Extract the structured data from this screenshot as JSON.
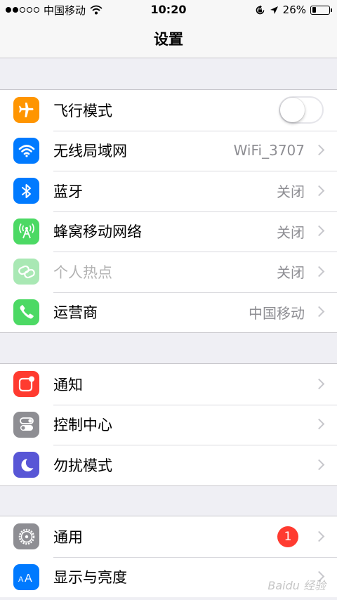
{
  "status_bar": {
    "carrier": "中国移动",
    "time": "10:20",
    "battery_percent": "26%",
    "battery_level": 0.26
  },
  "nav": {
    "title": "设置"
  },
  "groups": [
    [
      {
        "label": "飞行模式",
        "icon": "airplane-icon",
        "color": "#ff9500",
        "toggle": false
      },
      {
        "label": "无线局域网",
        "icon": "wifi-icon",
        "color": "#007aff",
        "value": "WiFi_3707"
      },
      {
        "label": "蓝牙",
        "icon": "bluetooth-icon",
        "color": "#007aff",
        "value": "关闭"
      },
      {
        "label": "蜂窝移动网络",
        "icon": "cellular-antenna-icon",
        "color": "#4cd964",
        "value": "关闭"
      },
      {
        "label": "个人热点",
        "icon": "hotspot-link-icon",
        "color": "#a9e8b4",
        "value": "关闭",
        "disabled": true
      },
      {
        "label": "运营商",
        "icon": "phone-icon",
        "color": "#4cd964",
        "value": "中国移动"
      }
    ],
    [
      {
        "label": "通知",
        "icon": "notifications-icon",
        "color": "#ff3b30"
      },
      {
        "label": "控制中心",
        "icon": "control-center-icon",
        "color": "#8e8e93"
      },
      {
        "label": "勿扰模式",
        "icon": "moon-icon",
        "color": "#5856d6"
      }
    ],
    [
      {
        "label": "通用",
        "icon": "gear-icon",
        "color": "#8e8e93",
        "badge": "1"
      },
      {
        "label": "显示与亮度",
        "icon": "display-brightness-icon",
        "color": "#007aff"
      }
    ]
  ],
  "watermark": "Baidu 经验"
}
